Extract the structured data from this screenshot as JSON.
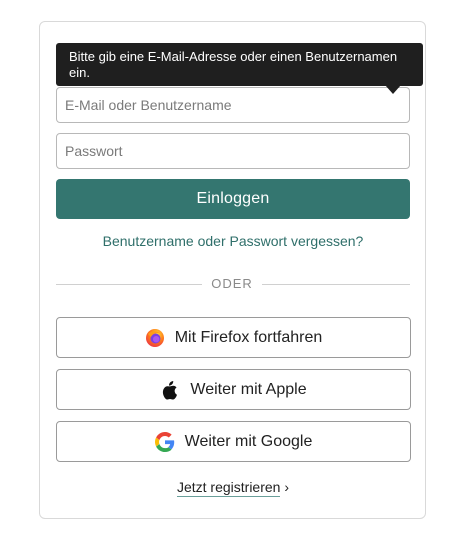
{
  "tooltip": {
    "text": "Bitte gib eine E-Mail-Adresse oder einen Benutzernamen ein."
  },
  "form": {
    "email_placeholder": "E-Mail oder Benutzername",
    "email_value": "",
    "password_placeholder": "Passwort",
    "password_value": "",
    "login_label": "Einloggen",
    "forgot_label": "Benutzername oder Passwort vergessen?"
  },
  "divider": {
    "label": "ODER"
  },
  "social": {
    "firefox": {
      "label": "Mit Firefox fortfahren",
      "icon": "firefox-icon"
    },
    "apple": {
      "label": "Weiter mit Apple",
      "icon": "apple-icon"
    },
    "google": {
      "label": "Weiter mit Google",
      "icon": "google-icon"
    }
  },
  "register": {
    "label": "Jetzt registrieren",
    "chevron": "›"
  },
  "colors": {
    "accent": "#347670",
    "link": "#2f6f6a",
    "tooltip_bg": "#1f1f1f",
    "border": "#d9d9d9"
  }
}
